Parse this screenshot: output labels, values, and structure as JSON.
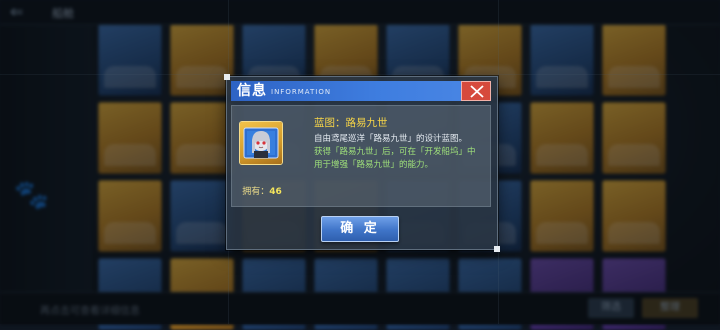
{
  "background": {
    "page_title": "船舱",
    "bottom_hint": "再点击可查看详细信息",
    "bottom_buttons": [
      "筛选",
      "整理"
    ]
  },
  "dialog": {
    "title": "信息",
    "subtitle": "INFORMATION",
    "item_name": "蓝图：路易九世",
    "desc_line1": "自由鸢尾巡洋「路易九世」的设计蓝图。",
    "desc_line2a": "获得「路易九世」后，可在「开发船坞」中",
    "desc_line2b": "用于增强「路易九世」的能力。",
    "owned_label": "拥有：",
    "owned_count": "46",
    "confirm_label": "确 定",
    "close_icon": "close-icon"
  },
  "colors": {
    "header_blue": "#3f7ee0",
    "close_red": "#d64a3c",
    "name_yellow": "#f6d447",
    "desc_green": "#9fe07a"
  }
}
